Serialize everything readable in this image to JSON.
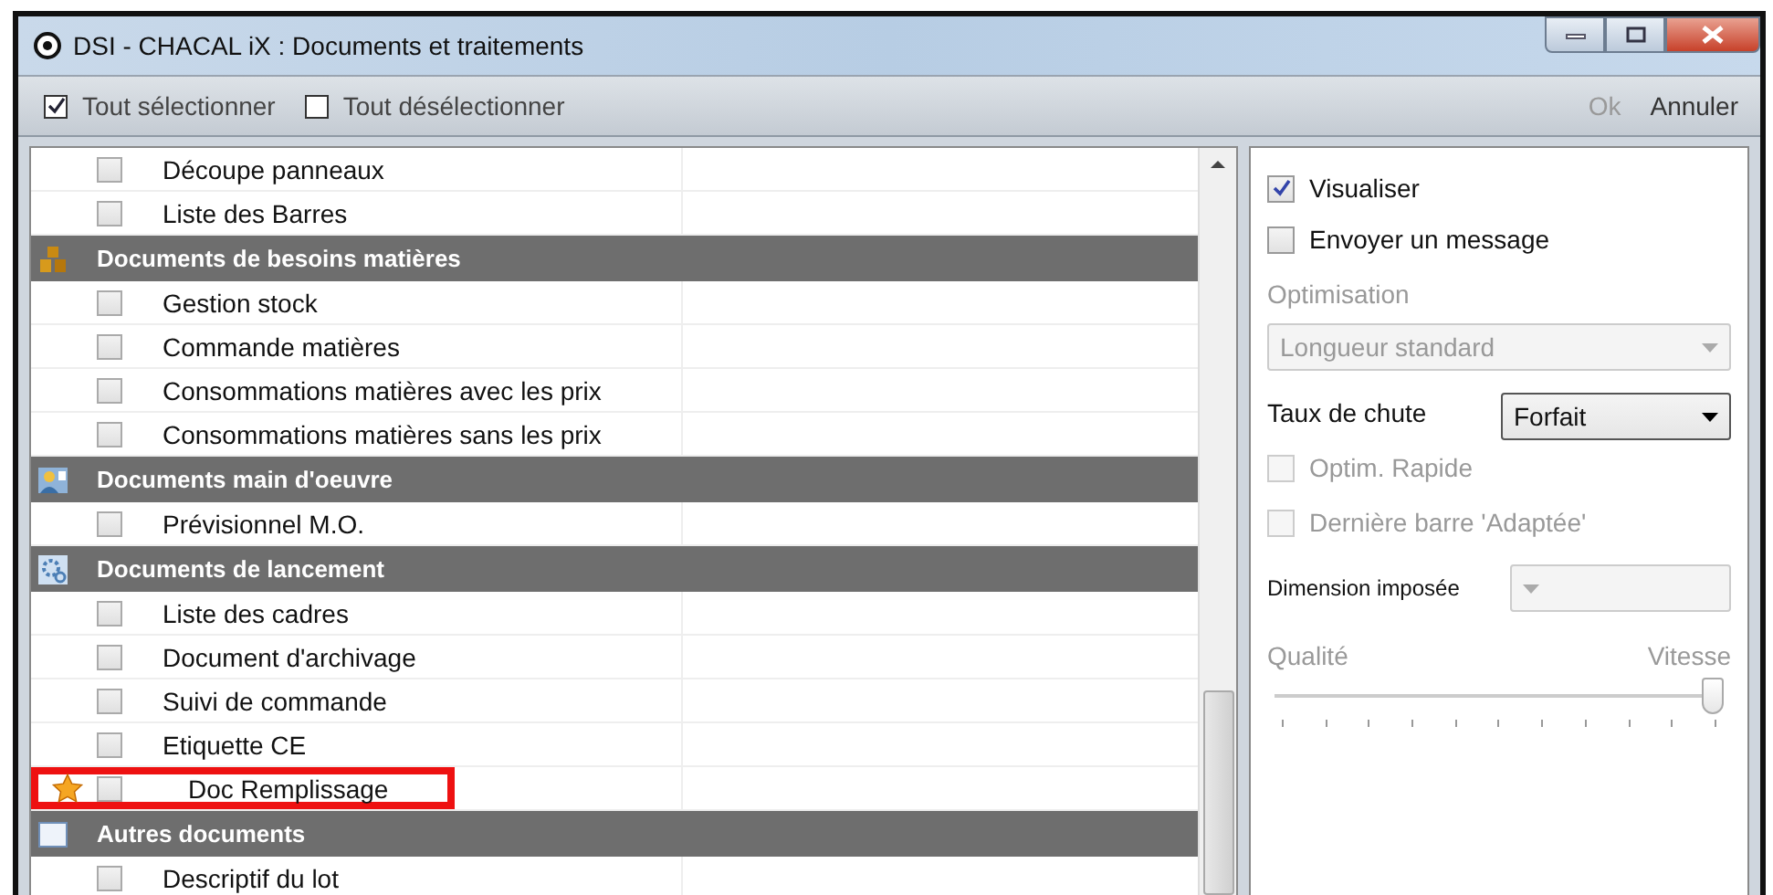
{
  "window": {
    "title": "DSI - CHACAL iX : Documents et traitements"
  },
  "toolbar": {
    "select_all": {
      "label": "Tout sélectionner",
      "checked": true
    },
    "deselect_all": {
      "label": "Tout désélectionner",
      "checked": false
    },
    "ok": {
      "label": "Ok",
      "disabled": true
    },
    "cancel": {
      "label": "Annuler",
      "disabled": false
    }
  },
  "list": {
    "rows": [
      {
        "kind": "item",
        "label": "Découpe panneaux",
        "checked": false,
        "starred": false,
        "highlighted": false
      },
      {
        "kind": "item",
        "label": "Liste  des Barres",
        "checked": false,
        "starred": false,
        "highlighted": false
      },
      {
        "kind": "header",
        "label": "Documents de besoins matières"
      },
      {
        "kind": "item",
        "label": "Gestion stock",
        "checked": false,
        "starred": false,
        "highlighted": false
      },
      {
        "kind": "item",
        "label": "Commande matières",
        "checked": false,
        "starred": false,
        "highlighted": false
      },
      {
        "kind": "item",
        "label": "Consommations matières avec les prix",
        "checked": false,
        "starred": false,
        "highlighted": false
      },
      {
        "kind": "item",
        "label": "Consommations matières sans les prix",
        "checked": false,
        "starred": false,
        "highlighted": false
      },
      {
        "kind": "header",
        "label": "Documents main d'oeuvre"
      },
      {
        "kind": "item",
        "label": "Prévisionnel M.O.",
        "checked": false,
        "starred": false,
        "highlighted": false
      },
      {
        "kind": "header",
        "label": "Documents de lancement"
      },
      {
        "kind": "item",
        "label": "Liste des cadres",
        "checked": false,
        "starred": false,
        "highlighted": false
      },
      {
        "kind": "item",
        "label": "Document d'archivage",
        "checked": false,
        "starred": false,
        "highlighted": false
      },
      {
        "kind": "item",
        "label": "Suivi de commande",
        "checked": false,
        "starred": false,
        "highlighted": false
      },
      {
        "kind": "item",
        "label": "Etiquette CE",
        "checked": false,
        "starred": false,
        "highlighted": false
      },
      {
        "kind": "item",
        "label": "Doc Remplissage",
        "checked": false,
        "starred": true,
        "highlighted": true
      },
      {
        "kind": "header",
        "label": "Autres documents"
      },
      {
        "kind": "item",
        "label": "Descriptif du lot",
        "checked": false,
        "starred": false,
        "highlighted": false
      }
    ]
  },
  "options": {
    "visualiser": {
      "label": "Visualiser",
      "checked": true,
      "disabled": false
    },
    "send_message": {
      "label": "Envoyer un message",
      "checked": false,
      "disabled": false
    },
    "optimisation": {
      "label": "Optimisation",
      "value": "Longueur standard",
      "disabled": true
    },
    "scrap_rate": {
      "label": "Taux de chute",
      "value": "Forfait",
      "disabled": false
    },
    "fast_optim": {
      "label": "Optim. Rapide",
      "checked": false,
      "disabled": true
    },
    "last_bar": {
      "label": "Dernière barre 'Adaptée'",
      "checked": false,
      "disabled": true
    },
    "imposed_dimension": {
      "label": "Dimension imposée",
      "disabled": true
    },
    "slider": {
      "min_label": "Qualité",
      "max_label": "Vitesse",
      "level": 1,
      "disabled": true
    }
  }
}
